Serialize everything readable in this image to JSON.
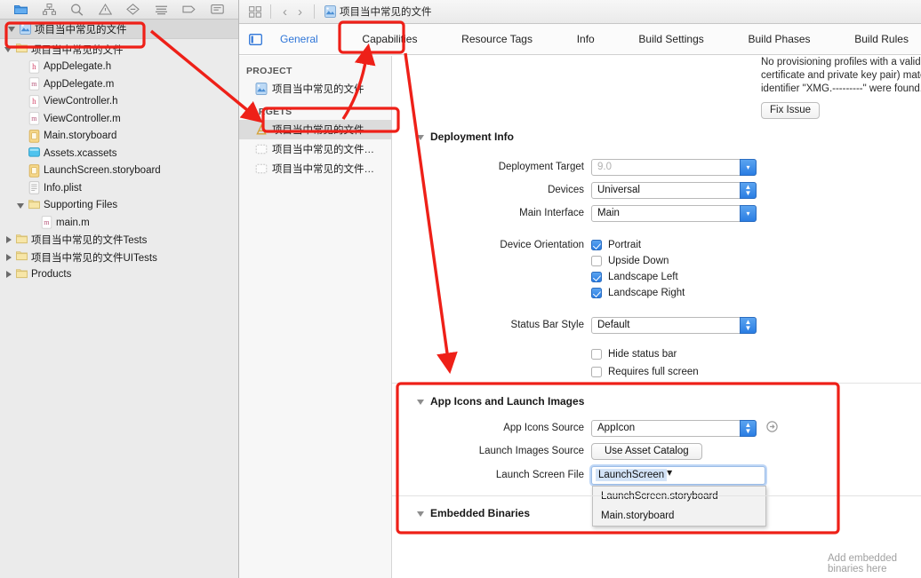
{
  "navigator": {
    "toolbar_icons": [
      "folder-icon",
      "hierarchy-icon",
      "search-icon",
      "warning-icon",
      "issue-icon",
      "test-icon",
      "tag-icon",
      "report-icon"
    ],
    "project_row": {
      "label": "项目当中常见的文件",
      "icon": "xcode-project-icon"
    },
    "tree": [
      {
        "label": "项目当中常见的文件",
        "icon": "folder-icon",
        "indent": 1,
        "disclosure": "open"
      },
      {
        "label": "AppDelegate.h",
        "icon": "header-file-icon",
        "indent": 2,
        "disclosure": "none"
      },
      {
        "label": "AppDelegate.m",
        "icon": "source-file-icon",
        "indent": 2,
        "disclosure": "none"
      },
      {
        "label": "ViewController.h",
        "icon": "header-file-icon",
        "indent": 2,
        "disclosure": "none"
      },
      {
        "label": "ViewController.m",
        "icon": "source-file-icon",
        "indent": 2,
        "disclosure": "none"
      },
      {
        "label": "Main.storyboard",
        "icon": "storyboard-icon",
        "indent": 2,
        "disclosure": "none"
      },
      {
        "label": "Assets.xcassets",
        "icon": "assets-catalog-icon",
        "indent": 2,
        "disclosure": "none"
      },
      {
        "label": "LaunchScreen.storyboard",
        "icon": "storyboard-icon",
        "indent": 2,
        "disclosure": "none"
      },
      {
        "label": "Info.plist",
        "icon": "plist-icon",
        "indent": 2,
        "disclosure": "none"
      },
      {
        "label": "Supporting Files",
        "icon": "folder-icon",
        "indent": 2,
        "disclosure": "open"
      },
      {
        "label": "main.m",
        "icon": "source-file-icon",
        "indent": 3,
        "disclosure": "none"
      },
      {
        "label": "项目当中常见的文件Tests",
        "icon": "folder-icon",
        "indent": 1,
        "disclosure": "closed"
      },
      {
        "label": "项目当中常见的文件UITests",
        "icon": "folder-icon",
        "indent": 1,
        "disclosure": "closed"
      },
      {
        "label": "Products",
        "icon": "folder-icon",
        "indent": 1,
        "disclosure": "closed"
      }
    ]
  },
  "jump_bar": {
    "grid_icon": "grid-icon",
    "back_icon": "chevron-left-icon",
    "forward_icon": "chevron-right-icon",
    "title": "项目当中常见的文件",
    "title_icon": "xcode-project-icon"
  },
  "tabs": {
    "side_toggle_icon": "sidebar-toggle-icon",
    "items": [
      {
        "label": "General",
        "selected": true
      },
      {
        "label": "Capabilities",
        "selected": false
      },
      {
        "label": "Resource Tags",
        "selected": false
      },
      {
        "label": "Info",
        "selected": false
      },
      {
        "label": "Build Settings",
        "selected": false
      },
      {
        "label": "Build Phases",
        "selected": false
      },
      {
        "label": "Build Rules",
        "selected": false
      }
    ]
  },
  "target_list": {
    "project_header": "PROJECT",
    "targets_header": "TARGETS",
    "project_items": [
      {
        "label": "项目当中常见的文件",
        "icon": "xcode-project-icon"
      }
    ],
    "target_items": [
      {
        "label": "项目当中常见的文件",
        "icon": "app-target-icon",
        "selected": true
      },
      {
        "label": "项目当中常见的文件…",
        "icon": "test-target-icon",
        "selected": false
      },
      {
        "label": "项目当中常见的文件…",
        "icon": "test-target-icon",
        "selected": false
      }
    ]
  },
  "general": {
    "signing_warning": "No provisioning profiles with a valid signing identity (i.e. certificate and private key pair) matching the bundle identifier \"XMG.---------\" were found.",
    "fix_issue_label": "Fix Issue",
    "deployment_info": {
      "title": "Deployment Info",
      "deployment_target_label": "Deployment Target",
      "deployment_target_placeholder": "9.0",
      "deployment_target_value": "",
      "devices_label": "Devices",
      "devices_value": "Universal",
      "main_interface_label": "Main Interface",
      "main_interface_value": "Main",
      "device_orientation_label": "Device Orientation",
      "orientations": [
        {
          "label": "Portrait",
          "checked": true
        },
        {
          "label": "Upside Down",
          "checked": false
        },
        {
          "label": "Landscape Left",
          "checked": true
        },
        {
          "label": "Landscape Right",
          "checked": true
        }
      ],
      "status_bar_style_label": "Status Bar Style",
      "status_bar_style_value": "Default",
      "extra_options": [
        {
          "label": "Hide status bar",
          "checked": false
        },
        {
          "label": "Requires full screen",
          "checked": false
        }
      ]
    },
    "app_icons": {
      "title": "App Icons and Launch Images",
      "app_icons_source_label": "App Icons Source",
      "app_icons_source_value": "AppIcon",
      "app_icons_source_aux_icon": "open-arrow-icon",
      "launch_images_source_label": "Launch Images Source",
      "launch_images_source_button": "Use Asset Catalog",
      "launch_screen_file_label": "Launch Screen File",
      "launch_screen_file_value": "LaunchScreen",
      "launch_screen_menu": [
        "LaunchScreen.storyboard",
        "Main.storyboard"
      ]
    },
    "embedded_binaries": {
      "title": "Embedded Binaries",
      "empty_hint": "Add embedded binaries here"
    }
  },
  "annotations": {
    "highlight_color": "#ee2018",
    "boxes": [
      {
        "name": "project-root-highlight"
      },
      {
        "name": "general-tab-highlight"
      },
      {
        "name": "selected-target-highlight"
      },
      {
        "name": "app-icons-section-highlight"
      }
    ],
    "arrows": [
      {
        "name": "arrow-project-to-target"
      },
      {
        "name": "arrow-target-to-general"
      },
      {
        "name": "arrow-general-to-app-icons"
      }
    ]
  }
}
